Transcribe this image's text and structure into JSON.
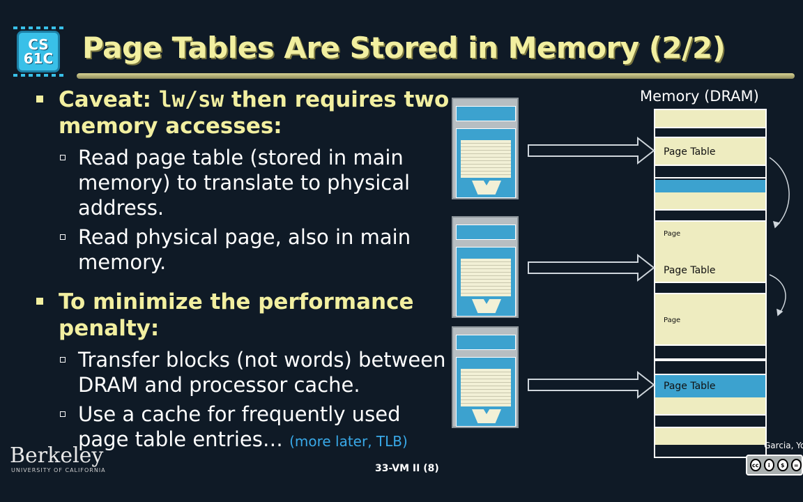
{
  "logo": {
    "line1": "CS",
    "line2": "61C"
  },
  "title": "Page Tables Are Stored in Memory (2/2)",
  "bullets": [
    {
      "pre": "Caveat: ",
      "code": "lw/sw",
      "post": " then requires two memory accesses:",
      "subs": [
        "Read page table (stored in main memory) to translate to physical address.",
        "Read physical page, also in main memory."
      ]
    },
    {
      "text": "To minimize the performance penalty:",
      "subs": [
        "Transfer blocks (not words) between DRAM and processor cache.",
        "Use a cache for frequently used page table entries…"
      ],
      "accent": "(more later, TLB)"
    }
  ],
  "memory": {
    "title": "Memory (DRAM)",
    "labels": {
      "page_table": "Page Table",
      "page": "Page"
    }
  },
  "footer": {
    "university": "Berkeley",
    "university_sub": "UNIVERSITY OF CALIFORNIA",
    "slide_number": "33-VM II (8)",
    "author": "Garcia, Yo"
  },
  "license": {
    "items": [
      "cc",
      "i",
      "$",
      "="
    ],
    "by": "BY",
    "nc": "NC"
  },
  "colors": {
    "title": "#f2efa0",
    "accent": "#39a9e8",
    "memory_blue": "#3ca2cf",
    "memory_tan": "#eeecc0"
  }
}
